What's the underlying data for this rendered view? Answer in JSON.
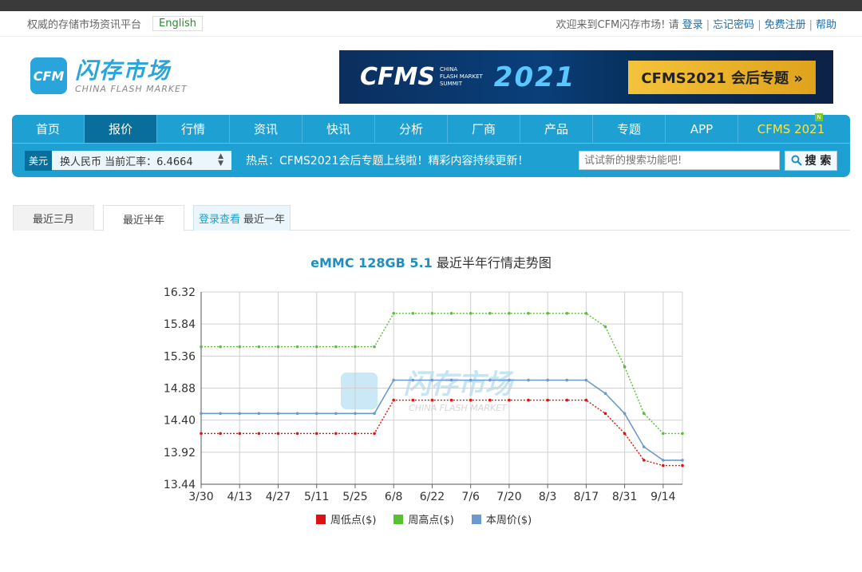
{
  "topbar": {
    "slogan": "权威的存储市场资讯平台",
    "lang": "English",
    "welcome": "欢迎来到CFM闪存市场! 请",
    "login": "登录",
    "forgot": "忘记密码",
    "register": "免费注册",
    "help": "帮助"
  },
  "header": {
    "logo_mark": "CFM",
    "logo_cn": "闪存市场",
    "logo_en": "CHINA FLASH MARKET",
    "banner_logo": "CFMS",
    "banner_sub": [
      "CHINA",
      "FLASH MARKET",
      "SUMMIT"
    ],
    "banner_year": "2021",
    "banner_cta": "CFMS2021 会后专题 »"
  },
  "nav": {
    "items": [
      "首页",
      "报价",
      "行情",
      "资讯",
      "快讯",
      "分析",
      "厂商",
      "产品",
      "专题",
      "APP"
    ],
    "last": "CFMS 2021",
    "badge": "N",
    "active_index": 1
  },
  "subnav": {
    "currency": "美元",
    "rate_text": "换人民币 当前汇率：6.4664",
    "hot": "热点：CFMS2021会后专题上线啦！精彩内容持续更新！",
    "search_placeholder": "试试新的搜索功能吧!",
    "search_btn": "搜 索"
  },
  "tabs": {
    "t1": "最近三月",
    "t2": "最近半年",
    "login_link": "登录查看",
    "t3": "最近一年"
  },
  "chart_title": {
    "product": "eMMC 128GB 5.1",
    "suffix": " 最近半年行情走势图"
  },
  "chart_data": {
    "type": "line",
    "ylim": [
      13.44,
      16.32
    ],
    "yticks": [
      "16.32",
      "15.84",
      "15.36",
      "14.88",
      "14.40",
      "13.92",
      "13.44"
    ],
    "xticks": [
      "3/30",
      "4/13",
      "4/27",
      "5/11",
      "5/25",
      "6/8",
      "6/22",
      "7/6",
      "7/20",
      "8/3",
      "8/17",
      "8/31",
      "9/14"
    ],
    "points_per_tick": 2,
    "series": [
      {
        "name": "周低点($)",
        "color": "#dd1111",
        "values": [
          14.2,
          14.2,
          14.2,
          14.2,
          14.2,
          14.2,
          14.2,
          14.2,
          14.2,
          14.2,
          14.7,
          14.7,
          14.7,
          14.7,
          14.7,
          14.7,
          14.7,
          14.7,
          14.7,
          14.7,
          14.7,
          14.5,
          14.2,
          13.8,
          13.72,
          13.72
        ]
      },
      {
        "name": "周高点($)",
        "color": "#55c230",
        "values": [
          15.5,
          15.5,
          15.5,
          15.5,
          15.5,
          15.5,
          15.5,
          15.5,
          15.5,
          15.5,
          16.0,
          16.0,
          16.0,
          16.0,
          16.0,
          16.0,
          16.0,
          16.0,
          16.0,
          16.0,
          16.0,
          15.8,
          15.2,
          14.5,
          14.2,
          14.2
        ]
      },
      {
        "name": "本周价($)",
        "color": "#6a9ad0",
        "values": [
          14.5,
          14.5,
          14.5,
          14.5,
          14.5,
          14.5,
          14.5,
          14.5,
          14.5,
          14.5,
          15.0,
          15.0,
          15.0,
          15.0,
          15.0,
          15.0,
          15.0,
          15.0,
          15.0,
          15.0,
          15.0,
          14.8,
          14.5,
          14.0,
          13.8,
          13.8
        ]
      }
    ],
    "watermark_cn": "闪存市场",
    "watermark_en": "CHINA FLASH MARKET",
    "grid": true,
    "legend": "bottom"
  }
}
